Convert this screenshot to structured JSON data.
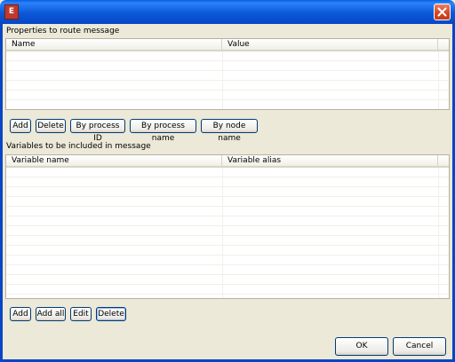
{
  "window": {
    "icon_glyph": "E",
    "close_icon": "close-x-icon"
  },
  "properties": {
    "label": "Properties to route message",
    "columns": [
      "Name",
      "Value"
    ],
    "buttons": [
      "Add",
      "Delete",
      "By process ID",
      "By process name",
      "By node name"
    ]
  },
  "variables": {
    "label": "Variables to be included in message",
    "columns": [
      "Variable name",
      "Variable alias"
    ],
    "buttons": [
      "Add",
      "Add all",
      "Edit",
      "Delete"
    ]
  },
  "dialog": {
    "ok_label": "OK",
    "cancel_label": "Cancel"
  }
}
